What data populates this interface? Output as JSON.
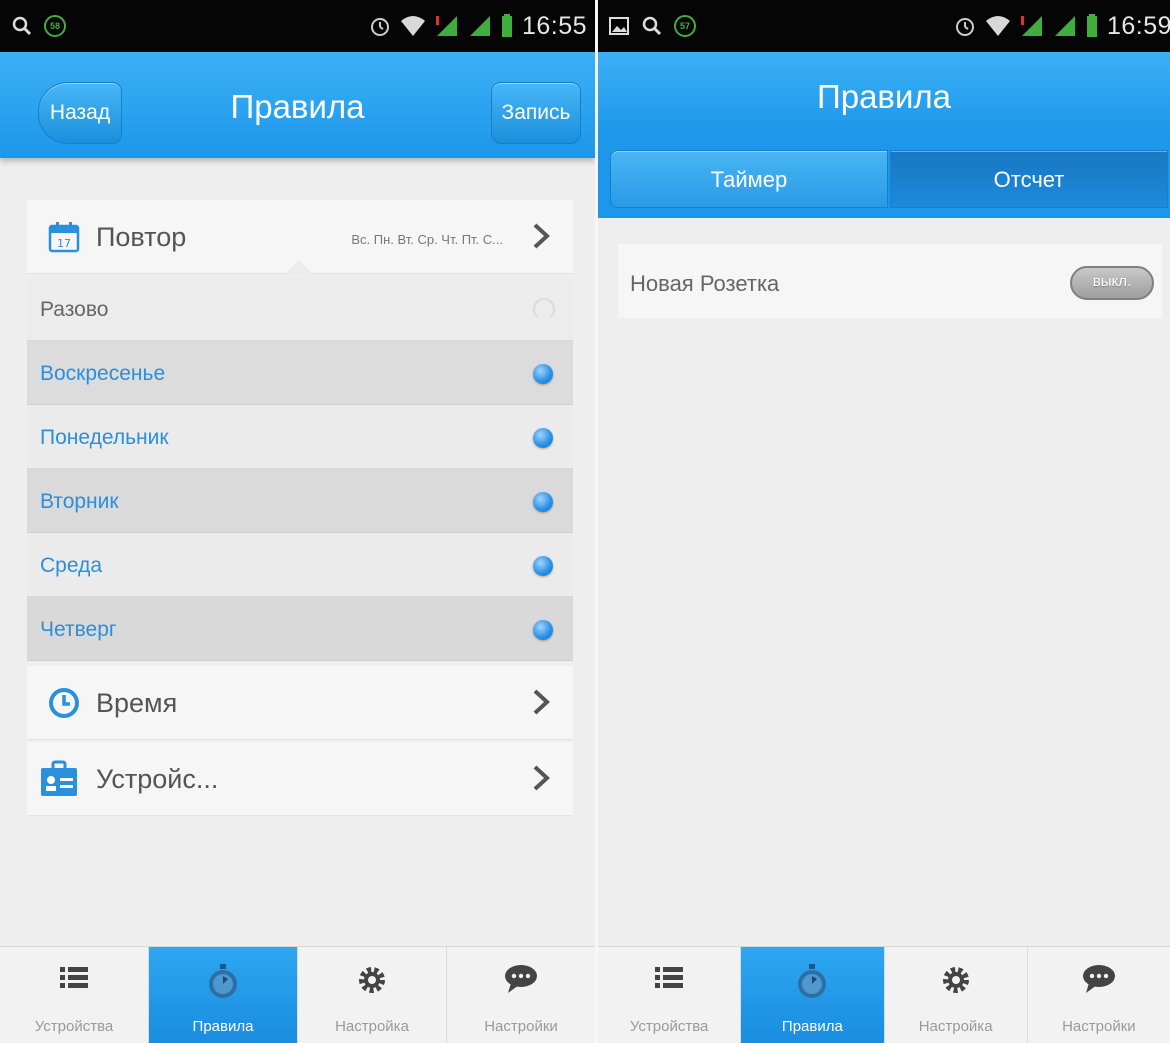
{
  "left_screen": {
    "status_bar": {
      "time": "16:55",
      "notification_badge": "58"
    },
    "header": {
      "title": "Правила",
      "back_label": "Назад",
      "save_label": "Запись"
    },
    "repeat": {
      "label": "Повтор",
      "summary": "Вс. Пн. Вт. Ср. Чт. Пт. С...",
      "icon": "calendar-icon"
    },
    "days": [
      {
        "label": "Разово",
        "selected": false
      },
      {
        "label": "Воскресенье",
        "selected": true
      },
      {
        "label": "Понедельник",
        "selected": true
      },
      {
        "label": "Вторник",
        "selected": true
      },
      {
        "label": "Среда",
        "selected": true
      },
      {
        "label": "Четверг",
        "selected": true
      }
    ],
    "time_row": {
      "label": "Время",
      "icon": "clock-icon"
    },
    "device_row": {
      "label": "Устройс...",
      "icon": "device-id-icon"
    }
  },
  "right_screen": {
    "status_bar": {
      "time": "16:59",
      "notification_badge": "57"
    },
    "header": {
      "title": "Правила"
    },
    "tabs": [
      {
        "label": "Таймер",
        "active": false
      },
      {
        "label": "Отсчет",
        "active": true
      }
    ],
    "rule": {
      "name": "Новая Розетка",
      "toggle_label": "выкл."
    }
  },
  "bottom_nav": [
    {
      "label": "Устройства",
      "icon": "list-icon",
      "active": false
    },
    {
      "label": "Правила",
      "icon": "stopwatch-icon",
      "active": true
    },
    {
      "label": "Настройка",
      "icon": "gear-icon",
      "active": false
    },
    {
      "label": "Настройки",
      "icon": "chat-bubble-icon",
      "active": false
    }
  ],
  "colors": {
    "accent": "#1d97ea",
    "day_text": "#2a8fdc",
    "toggle_off": "#a8a8a8"
  }
}
